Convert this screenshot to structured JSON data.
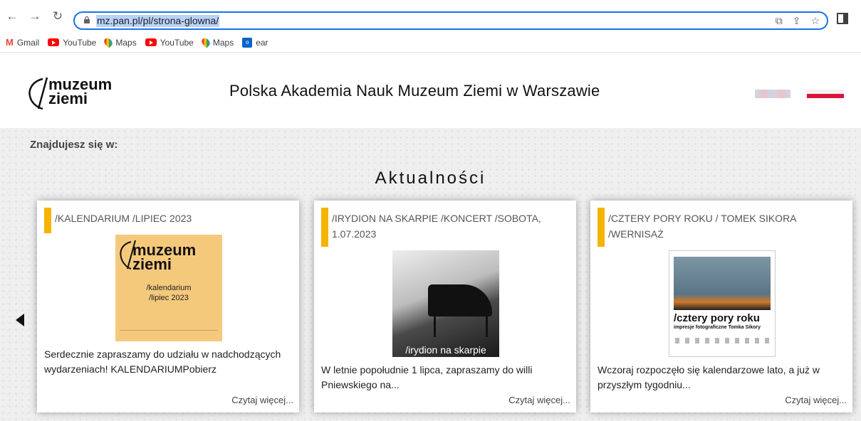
{
  "browser": {
    "url": "mz.pan.pl/pl/strona-glowna/",
    "bookmarks": [
      {
        "label": "Gmail",
        "icon": "gmail-icon"
      },
      {
        "label": "YouTube",
        "icon": "youtube-icon"
      },
      {
        "label": "Maps",
        "icon": "maps-icon"
      },
      {
        "label": "YouTube",
        "icon": "youtube-icon"
      },
      {
        "label": "Maps",
        "icon": "maps-icon"
      },
      {
        "label": "ear",
        "icon": "outlook-icon"
      }
    ]
  },
  "site": {
    "logo_text": "muzeum ziemi",
    "title": "Polska Akademia Nauk Muzeum Ziemi w Warszawie",
    "breadcrumb": "Znajdujesz się w:",
    "section_title": "Aktualności"
  },
  "cards": [
    {
      "title": "/KALENDARIUM /LIPIEC 2023",
      "image_caption": "/kalendarium /lipiec 2023",
      "image_logo": "muzeum ziemi",
      "text": "Serdecznie zapraszamy do udziału w nadchodzących wydarzeniach! KALENDARIUMPobierz",
      "more": "Czytaj więcej..."
    },
    {
      "title": "/IRYDION NA SKARPIE /KONCERT /SOBOTA, 1.07.2023",
      "image_caption": "/irydion na skarpie",
      "text": "W letnie popołudnie 1 lipca, zapraszamy do willi Pniewskiego na...",
      "more": "Czytaj więcej..."
    },
    {
      "title": "/CZTERY PORY ROKU / TOMEK SIKORA /WERNISAŻ",
      "image_caption": "/cztery pory roku",
      "image_subcaption": "impresje fotograficzne Tomka Sikory",
      "text": "Wczoraj rozpoczęło się kalendarzowe lato, a już w przyszłym tygodniu...",
      "more": "Czytaj więcej..."
    }
  ],
  "colors": {
    "accent": "#f5b400",
    "omnibox_border": "#1a73e8"
  }
}
